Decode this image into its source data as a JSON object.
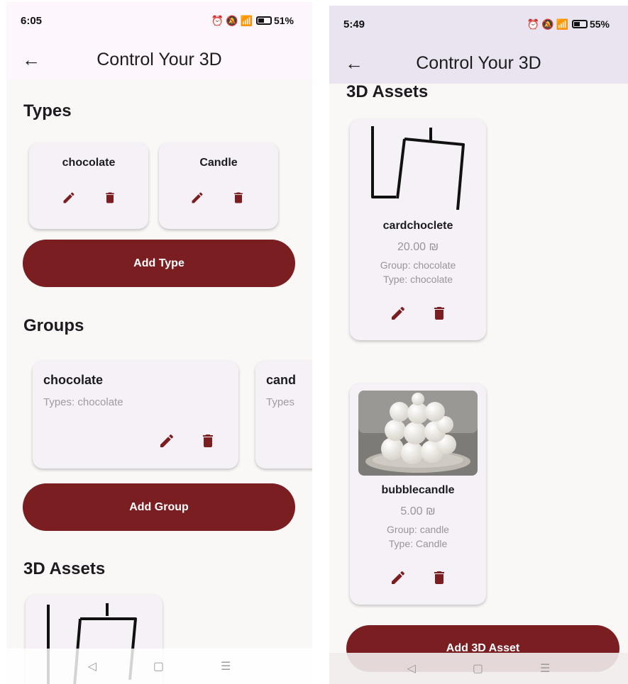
{
  "left": {
    "status": {
      "time": "6:05",
      "battery": "51%"
    },
    "appbar": {
      "title": "Control Your 3D"
    },
    "sections": {
      "types": "Types",
      "groups": "Groups",
      "assets": "3D Assets"
    },
    "types": [
      {
        "name": "chocolate"
      },
      {
        "name": "Candle"
      }
    ],
    "add_type_label": "Add Type",
    "groups": [
      {
        "name": "chocolate",
        "types_line": "Types: chocolate"
      },
      {
        "name": "cand",
        "types_line": "Types"
      }
    ],
    "add_group_label": "Add Group"
  },
  "right": {
    "status": {
      "time": "5:49",
      "battery": "55%"
    },
    "appbar": {
      "title": "Control Your 3D"
    },
    "sections": {
      "assets": "3D Assets"
    },
    "assets": [
      {
        "name": "cardchoclete",
        "price": "20.00 ₪",
        "group": "Group: chocolate",
        "type": "Type: chocolate"
      },
      {
        "name": "bubblecandle",
        "price": "5.00 ₪",
        "group": "Group: candle",
        "type": "Type: Candle"
      }
    ],
    "add_asset_label": "Add 3D Asset"
  },
  "colors": {
    "primary": "#7a1e22",
    "card": "#f5f1f6",
    "background": "#faf8f6",
    "appbar_left": "#fdf6fd",
    "appbar_right": "#e9e4ef"
  },
  "icons": [
    "back-arrow-icon",
    "edit-icon",
    "delete-icon",
    "alarm-icon",
    "mute-icon",
    "wifi-icon",
    "signal-icon",
    "battery-icon",
    "nav-back-icon",
    "nav-home-icon",
    "nav-menu-icon"
  ]
}
